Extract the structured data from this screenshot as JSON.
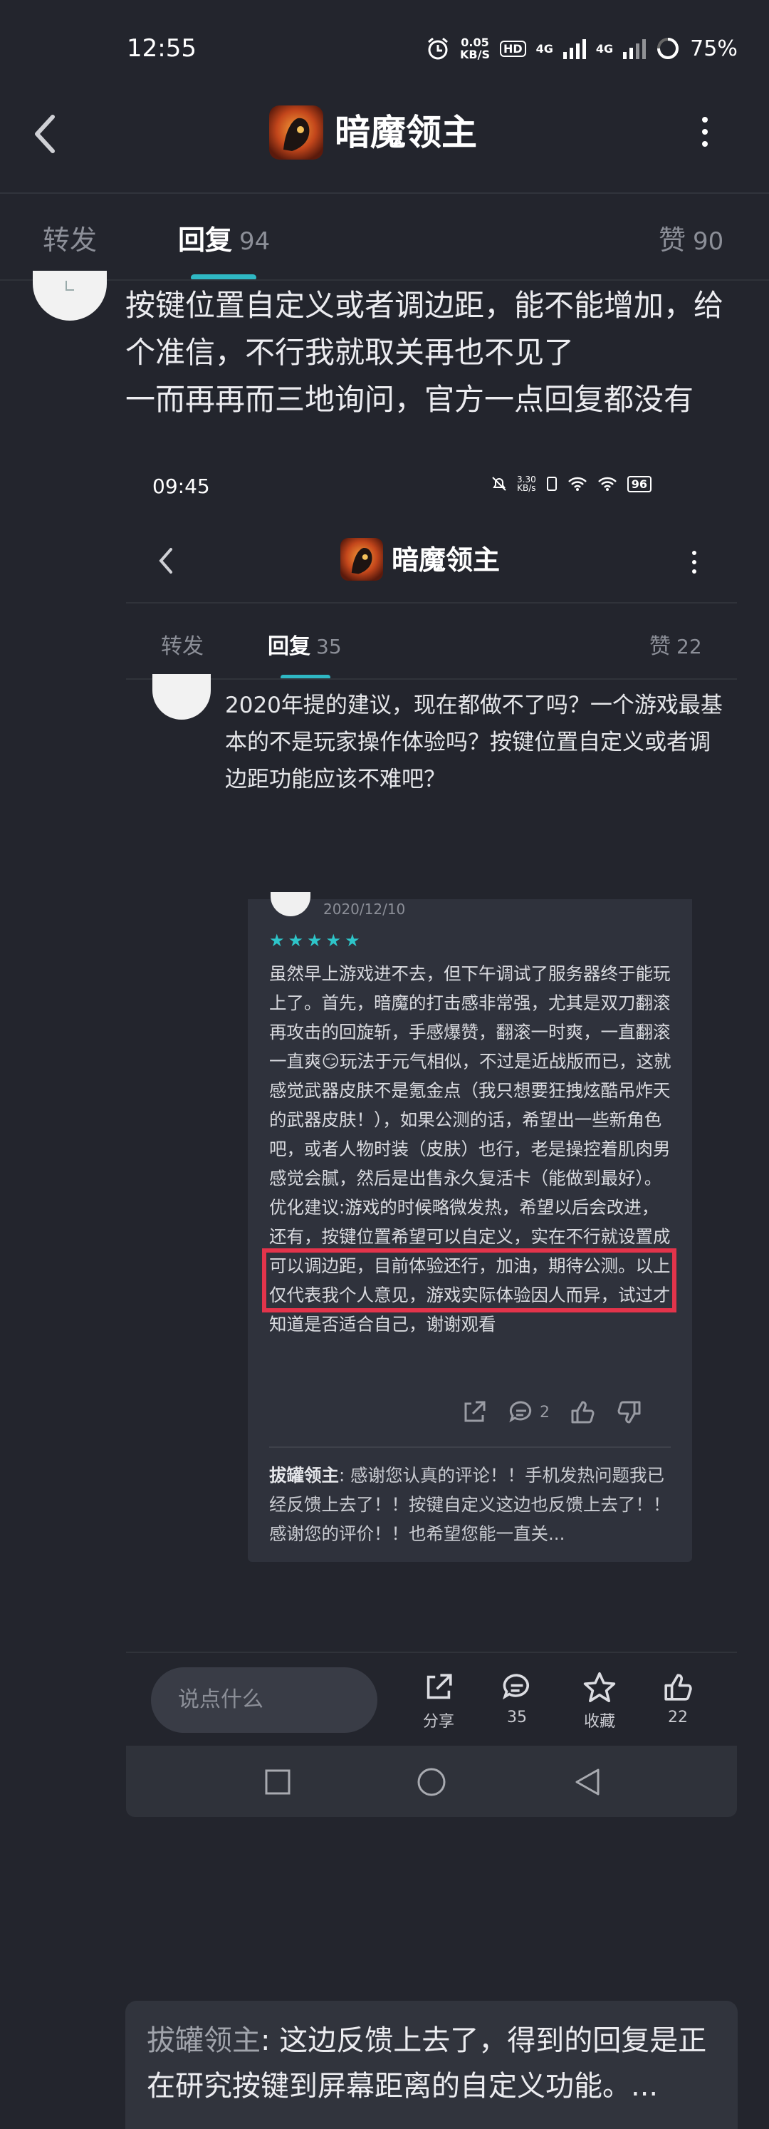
{
  "status_bar": {
    "time": "12:55",
    "speed_value": "0.05",
    "speed_unit": "KB/S",
    "hd": "HD",
    "network1": "4G",
    "network2": "4G",
    "battery": "75%"
  },
  "header": {
    "title": "暗魔领主",
    "back_icon": "chevron-left-icon",
    "more_icon": "more-vertical-icon"
  },
  "tabs": {
    "forward_label": "转发",
    "reply_label": "回复",
    "reply_count": "94",
    "likes_label": "赞",
    "likes_count": "90"
  },
  "post": {
    "text": "按键位置自定义或者调边距，能不能增加，给个准信，不行我就取关再也不见了\n一而再再而三地询问，官方一点回复都没有"
  },
  "embedded": {
    "status_time": "09:45",
    "status_speed": "3.30",
    "status_speed_unit": "KB/s",
    "battery": "96",
    "title": "暗魔领主",
    "tab_forward": "转发",
    "tab_reply": "回复",
    "tab_reply_count": "35",
    "tab_likes": "赞",
    "tab_likes_count": "22",
    "post_text": "2020年提的建议，现在都做不了吗？一个游戏最基本的不是玩家操作体验吗？按键位置自定义或者调边距功能应该不难吧？",
    "review": {
      "date": "2020/12/10",
      "stars": 5,
      "body": "虽然早上游戏进不去，但下午调试了服务器终于能玩上了。首先，暗魔的打击感非常强，尤其是双刀翻滚再攻击的回旋斩，手感爆赞，翻滚一时爽，一直翻滚一直爽😏玩法于元气相似，不过是近战版而已，这就感觉武器皮肤不是氪金点（我只想要狂拽炫酷吊炸天的武器皮肤！），如果公测的话，希望出一些新角色吧，或者人物时装（皮肤）也行，老是操控着肌肉男感觉会腻，然后是出售永久复活卡（能做到最好）。优化建议:游戏的时候略微发热，希望以后会改进，还有，按键位置希望可以自定义，实在不行就设置成可以调边距，目前体验还行，加油，期待公测。以上仅代表我个人意见，游戏实际体验因人而异，试过才知道是否适合自己，谢谢观看",
      "comment_count": "2",
      "reply_name": "拔罐领主",
      "reply_text": ": 感谢您认真的评论！！手机发热问题我已经反馈上去了！！按键自定义这边也反馈上去了！！感谢您的评价！！也希望您能一直关..."
    },
    "input_placeholder": "说点什么",
    "share_label": "分享",
    "comment_count": "35",
    "favorite_label": "收藏",
    "like_count": "22"
  },
  "bottom_reply": {
    "name": "拔罐领主",
    "text": ": 这边反馈上去了，得到的回复是正在研究按键到屏幕距离的自定义功能。..."
  },
  "colors": {
    "background": "#23252d",
    "accent": "#2fb8c4",
    "highlight": "#e3344b",
    "star": "#2ec5c9"
  }
}
